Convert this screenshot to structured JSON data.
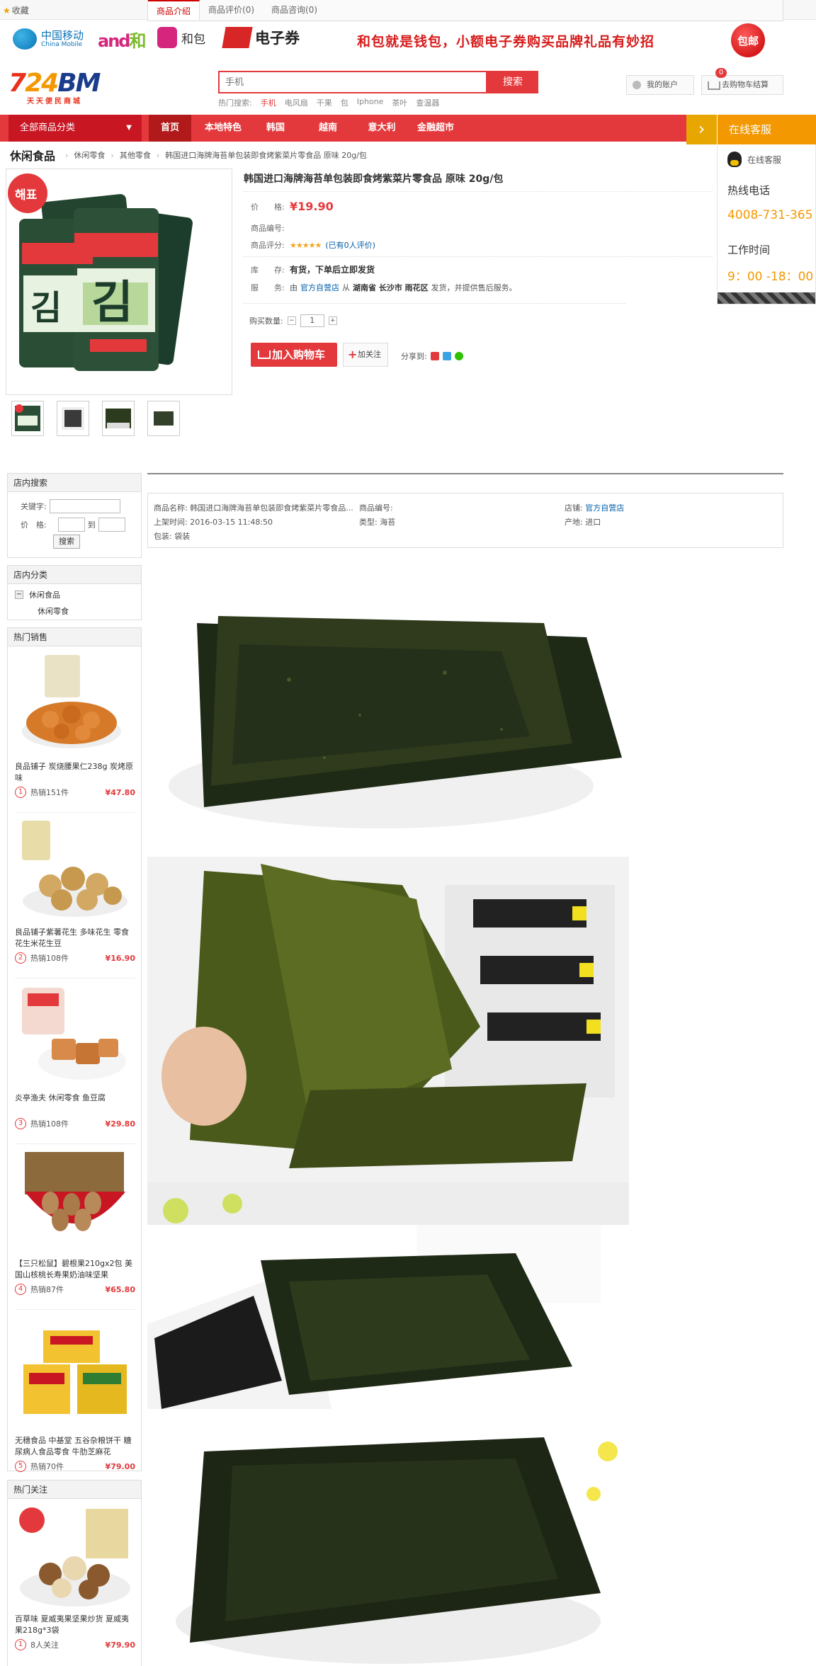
{
  "topbar": {
    "favorite": "收藏"
  },
  "float_tabs": [
    {
      "label": "商品介绍"
    },
    {
      "label": "商品评价(0)"
    },
    {
      "label": "商品咨询(0)"
    }
  ],
  "promo": {
    "china_mobile": "中国移动",
    "china_mobile_en": "China Mobile",
    "and_he_a": "and",
    "and_he_b": "和",
    "hebao": "和包",
    "dianziquan": "电子券",
    "slogan": "和包就是钱包，小额电子券购买品牌礼品有妙招",
    "baoyou": "包邮"
  },
  "header": {
    "logo_a": "7",
    "logo_b": "24",
    "logo_c": "BM",
    "logo_sub": "天天便民商城",
    "search_placeholder": "手机",
    "search_button": "搜索",
    "hot_label": "热门搜索:",
    "hot_terms": [
      "手机",
      "电风扇",
      "干果",
      "包",
      "Iphone",
      "茶叶",
      "查温器"
    ],
    "account": "我的账户",
    "cart": "去购物车结算",
    "cart_count": "0"
  },
  "nav": {
    "all_categories": "全部商品分类",
    "items": [
      "首页",
      "本地特色",
      "韩国",
      "越南",
      "意大利",
      "金融超市"
    ]
  },
  "service": {
    "title": "在线客服",
    "qq": "在线客服",
    "hotline_label": "热线电话",
    "hotline": "4008-731-365",
    "hours_label": "工作时间",
    "hours": "9：00 -18：00"
  },
  "breadcrumb": [
    "休闲食品",
    "休闲零食",
    "其他零食",
    "韩国进口海牌海苔单包装即食烤紫菜片零食品 原味 20g/包"
  ],
  "product": {
    "title": "韩国进口海牌海苔单包装即食烤紫菜片零食品 原味 20g/包",
    "price_label": "价　　格:",
    "price": "¥19.90",
    "code_label": "商品编号:",
    "rating_label": "商品评分:",
    "rating_stars": "★★★★★",
    "rating_text": "(已有0人评价)",
    "stock_label": "库　　存:",
    "stock": "有货，下单后立即发货",
    "service_label": "服　　务:",
    "service_pre": "由",
    "service_shop": "官方自营店",
    "service_mid": "从",
    "service_loc": "湖南省 长沙市 雨花区",
    "service_post": "发货，并提供售后服务。",
    "qty_label": "购买数量:",
    "qty": "1",
    "qty_minus": "−",
    "qty_plus": "+",
    "add_cart": "加入购物车",
    "follow": "加关注",
    "share": "分享到:",
    "image_brand": "해표",
    "image_word": "김"
  },
  "store_search": {
    "title": "店内搜索",
    "keyword_label": "关键字:",
    "price_label": "价　格:",
    "to": "到",
    "button": "搜索"
  },
  "store_category": {
    "title": "店内分类",
    "parent": "休闲食品",
    "child": "休闲零食"
  },
  "hot_sales": {
    "title": "热门销售",
    "items": [
      {
        "name": "良品铺子 炭烧腰果仁238g 炭烤原味",
        "rank": "1",
        "sold": "热销151件",
        "price": "¥47.80"
      },
      {
        "name": "良品铺子紫薯花生 多味花生 零食花生米花生豆",
        "rank": "2",
        "sold": "热销108件",
        "price": "¥16.90"
      },
      {
        "name": "炎亭渔夫 休闲零食 鱼豆腐",
        "rank": "3",
        "sold": "热销108件",
        "price": "¥29.80"
      },
      {
        "name": "【三只松鼠】碧根果210gx2包 美国山核桃长寿果奶油味坚果",
        "rank": "4",
        "sold": "热销87件",
        "price": "¥65.80"
      },
      {
        "name": "无穗食品 中基堂 五谷杂粮饼干 糖尿病人食品零食 牛肋芝麻花",
        "rank": "5",
        "sold": "热销70件",
        "price": "¥79.00"
      }
    ]
  },
  "hot_follow": {
    "title": "热门关注",
    "item": {
      "name": "百草味 夏威夷果坚果炒货 夏威夷果218g*3袋",
      "rank": "1",
      "sold": "8人关注",
      "price": "¥79.90"
    }
  },
  "spec": {
    "name_label": "商品名称:",
    "name": "韩国进口海牌海苔单包装即食烤紫菜片零食品...",
    "code_label": "商品编号:",
    "shop_label": "店铺:",
    "shop": "官方自营店",
    "time_label": "上架时间:",
    "time": "2016-03-15 11:48:50",
    "type_label": "类型:",
    "type": "海苔",
    "origin_label": "产地:",
    "origin": "进口",
    "package_label": "包装:",
    "package": "袋装"
  },
  "colors": {
    "brand_red": "#e4393c",
    "nav_red": "#e4393c",
    "service_orange": "#f39800"
  }
}
